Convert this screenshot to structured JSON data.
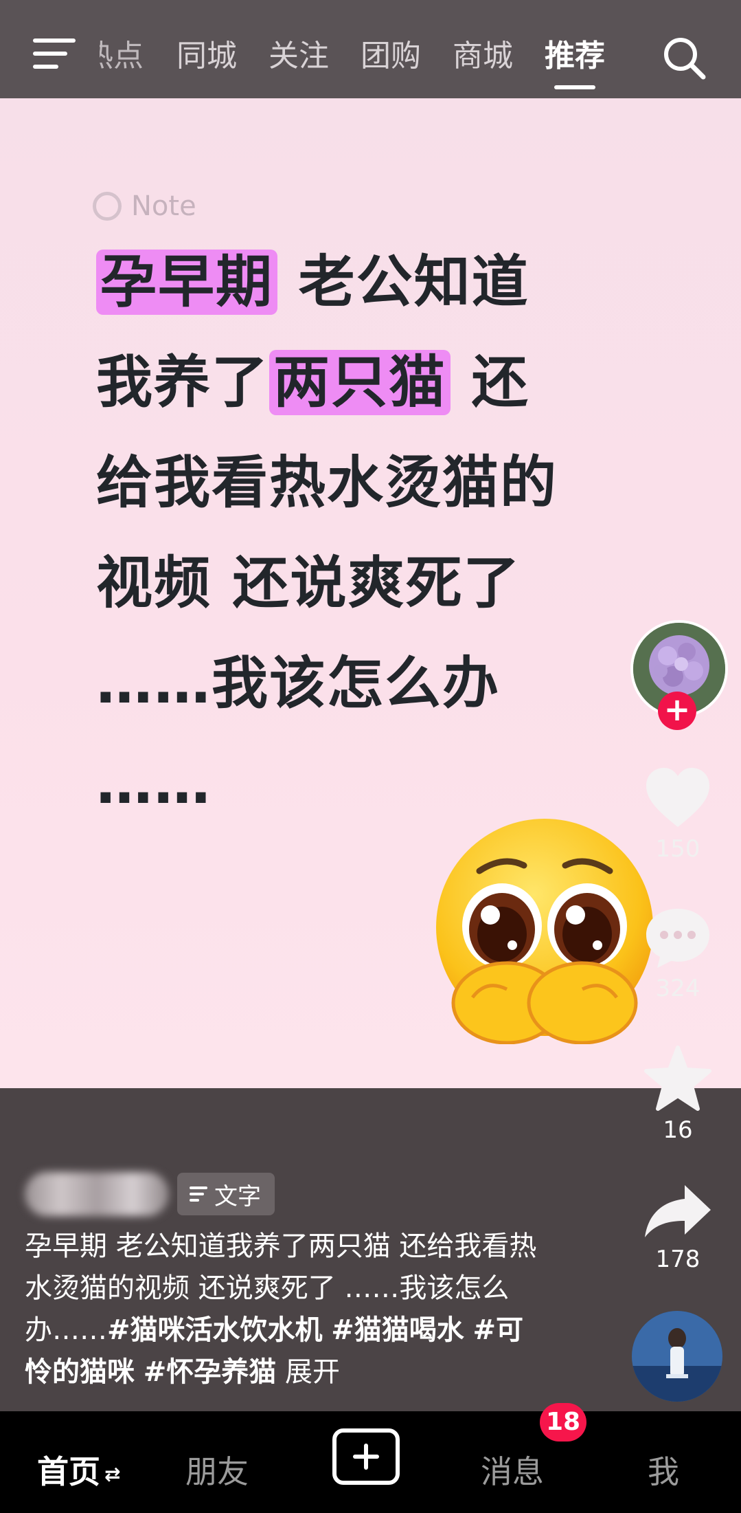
{
  "topbar": {
    "tabs": [
      "热点",
      "同城",
      "关注",
      "团购",
      "商城",
      "推荐"
    ],
    "active_tab": "推荐"
  },
  "post": {
    "note_label": "Note",
    "lines": [
      {
        "parts": [
          {
            "t": "孕早期",
            "hl": true
          },
          {
            "t": "  老公知道",
            "hl": false
          }
        ]
      },
      {
        "parts": [
          {
            "t": "我养了",
            "hl": false
          },
          {
            "t": "两只猫",
            "hl": true
          },
          {
            "t": "  还",
            "hl": false
          }
        ]
      },
      {
        "parts": [
          {
            "t": "给我看热水烫猫的",
            "hl": false
          }
        ]
      },
      {
        "parts": [
          {
            "t": "视频  还说爽死了",
            "hl": false
          }
        ]
      },
      {
        "parts": [
          {
            "t": "  ……我该怎么办",
            "hl": false
          }
        ]
      },
      {
        "parts": [
          {
            "t": "……",
            "hl": false
          }
        ]
      }
    ],
    "highlight_color": "#ee8cf4",
    "emoji": "pleading-face-emoji"
  },
  "info": {
    "tag_chip": "文字",
    "caption_text": "孕早期 老公知道我养了两只猫 还给我看热水烫猫的视频 还说爽死了 ……我该怎么办……",
    "hashtags": [
      "#猫咪活水饮水机",
      "#猫猫喝水",
      "#可怜的猫咪",
      "#怀孕养猫"
    ],
    "expand_label": "展开"
  },
  "actions": {
    "likes": "150",
    "comments": "324",
    "favorites": "16",
    "shares": "178"
  },
  "bottombar": {
    "home": "首页",
    "friends": "朋友",
    "messages": "消息",
    "messages_badge": "18",
    "me": "我"
  },
  "colors": {
    "topbar_bg": "#5a5356",
    "info_bg": "#4b4446",
    "badge": "#f6164b",
    "follow_plus": "#f1134a"
  }
}
